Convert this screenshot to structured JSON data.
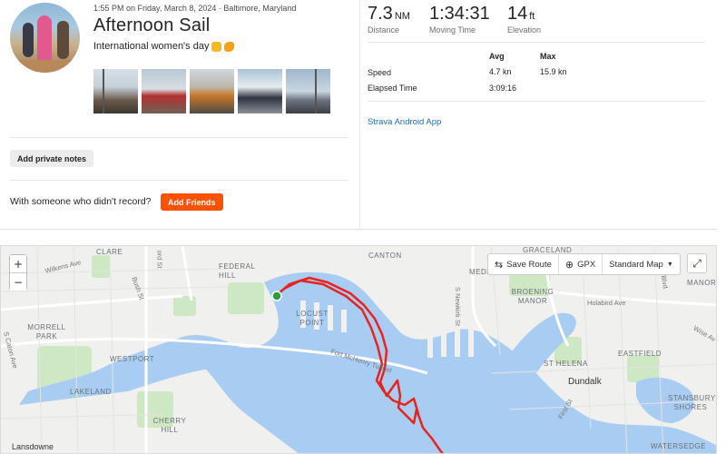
{
  "activity": {
    "meta": "1:55 PM on Friday, March 8, 2024 · Baltimore, Maryland",
    "title": "Afternoon Sail",
    "description": "International women's day",
    "photo_count": 5
  },
  "actions": {
    "add_private_notes": "Add private notes",
    "with_someone_text": "With someone who didn't record?",
    "add_friends": "Add Friends"
  },
  "stats": {
    "distance": {
      "value": "7.3",
      "unit": "NM",
      "label": "Distance"
    },
    "moving_time": {
      "value": "1:34:31",
      "label": "Moving Time"
    },
    "elevation": {
      "value": "14",
      "unit": "ft",
      "label": "Elevation"
    }
  },
  "table": {
    "col_avg": "Avg",
    "col_max": "Max",
    "speed_label": "Speed",
    "speed_avg": "4.7 kn",
    "speed_max": "15.9 kn",
    "elapsed_label": "Elapsed Time",
    "elapsed_value": "3:09:16"
  },
  "device": "Strava Android App",
  "map": {
    "zoom_in": "+",
    "zoom_out": "−",
    "save_route": "Save Route",
    "gpx": "GPX",
    "map_style": "Standard Map",
    "labels": {
      "clare": "CLARE",
      "federal_hill": "FEDERAL HILL",
      "canton": "CANTON",
      "graceland": "GRACELAND",
      "medford": "MEDF",
      "broening_manor": "BROENING MANOR",
      "manor": "MANOR",
      "locust_point": "LOCUST POINT",
      "morrell_park": "MORRELL PARK",
      "westport": "WESTPORT",
      "lakeland": "LAKELAND",
      "cherry_hill": "CHERRY HILL",
      "st_helena": "ST HELENA",
      "eastfield": "EASTFIELD",
      "dundalk": "Dundalk",
      "stansbury_shores": "STANSBURY SHORES",
      "watersedge": "WATERSEDGE",
      "lansdowne": "Lansdowne",
      "wilkens_ave": "Wilkens Ave",
      "bush_st": "Bush St",
      "s_caton_ave": "S Caton Ave",
      "fort_mchenry_tunnel": "Fort McHenry Tunnel",
      "holabird_ave": "Holabird Ave",
      "wise_av": "Wise Av",
      "s_newkirk_st": "S Newkirk St",
      "first_st": "First St",
      "blvd": "Blvd",
      "ord_st": "ord St"
    }
  },
  "colors": {
    "brand_orange": "#fc5200",
    "route_red": "#e8231f",
    "water": "#a9cdf2",
    "start_green": "#2a9d3f",
    "link_blue": "#1f6fa8"
  },
  "icons": [
    "save-route-icon",
    "gpx-download-icon",
    "chevron-down-icon",
    "fullscreen-icon",
    "start-marker-icon"
  ]
}
